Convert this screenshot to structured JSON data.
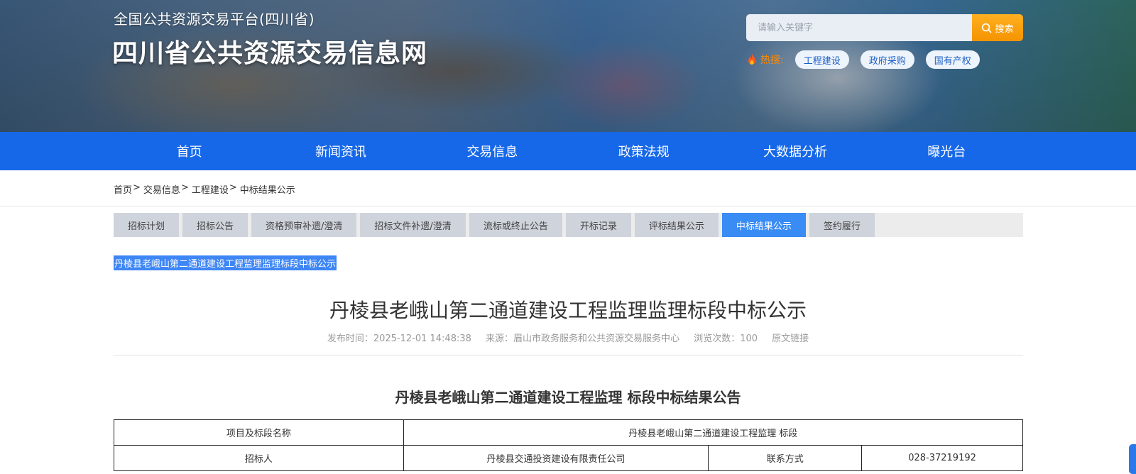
{
  "header": {
    "subtitle": "全国公共资源交易平台(四川省)",
    "title": "四川省公共资源交易信息网",
    "search": {
      "placeholder": "请输入关键字",
      "button_label": "搜索"
    },
    "hot": {
      "label": "热搜:",
      "tags": [
        "工程建设",
        "政府采购",
        "国有产权"
      ]
    }
  },
  "nav": {
    "items": [
      "首页",
      "新闻资讯",
      "交易信息",
      "政策法规",
      "大数据分析",
      "曝光台"
    ]
  },
  "breadcrumb": {
    "items": [
      "首页",
      "交易信息",
      "工程建设",
      "中标结果公示"
    ],
    "separator": ">"
  },
  "tabs": {
    "items": [
      "招标计划",
      "招标公告",
      "资格预审补遗/澄清",
      "招标文件补遗/澄清",
      "流标或终止公告",
      "开标记录",
      "评标结果公示",
      "中标结果公示",
      "签约履行"
    ],
    "active_index": 7
  },
  "selected_title": "丹棱县老峨山第二通道建设工程监理监理标段中标公示",
  "article": {
    "title": "丹棱县老峨山第二通道建设工程监理监理标段中标公示",
    "meta": {
      "publish_time": "发布时间：2025-12-01 14:48:38",
      "source": "来源：眉山市政务服务和公共资源交易服务中心",
      "views": "浏览次数：100",
      "original_link": "原文链接"
    },
    "notice_title": "丹棱县老峨山第二通道建设工程监理 标段中标结果公告",
    "table": {
      "row1": {
        "label": "项目及标段名称",
        "value": "丹棱县老峨山第二通道建设工程监理 标段"
      },
      "row2": {
        "label": "招标人",
        "value": "丹棱县交通投资建设有限责任公司",
        "contact_label": "联系方式",
        "contact_value": "028-37219192"
      }
    }
  },
  "colors": {
    "nav_bg": "#1668e8",
    "tab_active": "#3a8cf5",
    "search_button": "#f59300",
    "hot_label": "#ff8a00"
  }
}
